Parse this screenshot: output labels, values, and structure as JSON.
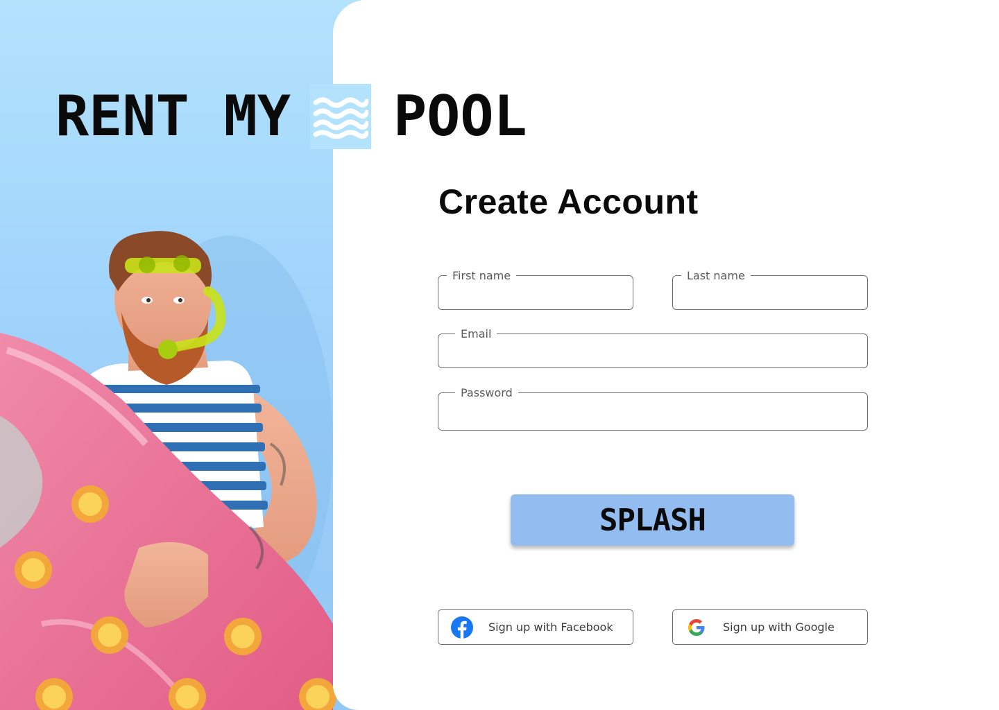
{
  "brand": {
    "word1": "RENT",
    "word2": "MY",
    "word3": "POOL",
    "wave_icon": "wave-icon",
    "accent": "#b3e2fd"
  },
  "form": {
    "title": "Create Account",
    "first_name_label": "First name",
    "last_name_label": "Last name",
    "email_label": "Email",
    "password_label": "Password",
    "submit_label": "SPLASH",
    "submit_color": "#93bdf0"
  },
  "social": {
    "facebook_label": "Sign up with Facebook",
    "google_label": "Sign up with Google",
    "facebook_icon": "facebook-icon",
    "google_icon": "google-icon"
  }
}
